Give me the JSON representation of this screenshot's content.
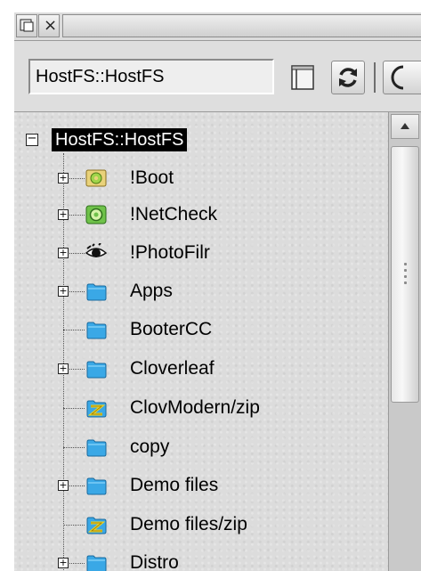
{
  "titlebar": {
    "back_icon": "back-window-icon",
    "close_icon": "close-icon",
    "close_glyph": "×"
  },
  "toolbar": {
    "path_value": "HostFS::HostFS",
    "pane_icon": "pane-toggle-icon",
    "refresh_icon": "refresh-icon",
    "more_icon": "more-options-icon"
  },
  "tree": {
    "root": {
      "label": "HostFS::HostFS",
      "expanded": true,
      "selected": true,
      "expander_glyph": "−"
    },
    "items": [
      {
        "label": "!Boot",
        "icon": "boot-app-icon",
        "expandable": true,
        "expander_glyph": "+"
      },
      {
        "label": "!NetCheck",
        "icon": "netcheck-app-icon",
        "expandable": true,
        "expander_glyph": "+"
      },
      {
        "label": "!PhotoFilr",
        "icon": "photofilr-app-icon",
        "expandable": true,
        "expander_glyph": "+"
      },
      {
        "label": "Apps",
        "icon": "folder-icon",
        "expandable": true,
        "expander_glyph": "+"
      },
      {
        "label": "BooterCC",
        "icon": "folder-icon",
        "expandable": false,
        "expander_glyph": ""
      },
      {
        "label": "Cloverleaf",
        "icon": "folder-icon",
        "expandable": true,
        "expander_glyph": "+"
      },
      {
        "label": "ClovModern/zip",
        "icon": "zip-archive-icon",
        "expandable": false,
        "expander_glyph": ""
      },
      {
        "label": "copy",
        "icon": "folder-icon",
        "expandable": false,
        "expander_glyph": ""
      },
      {
        "label": "Demo files",
        "icon": "folder-icon",
        "expandable": true,
        "expander_glyph": "+"
      },
      {
        "label": "Demo files/zip",
        "icon": "zip-archive-icon",
        "expandable": false,
        "expander_glyph": ""
      },
      {
        "label": "Distro",
        "icon": "folder-icon",
        "expandable": true,
        "expander_glyph": "+"
      }
    ]
  },
  "scrollbar": {
    "up_icon": "scroll-up-arrow-icon",
    "thumb_position": 0.0
  },
  "colors": {
    "selection_bg": "#000000",
    "selection_fg": "#ffffff",
    "folder": "#3aa8e6",
    "background": "#dcdcdc"
  }
}
